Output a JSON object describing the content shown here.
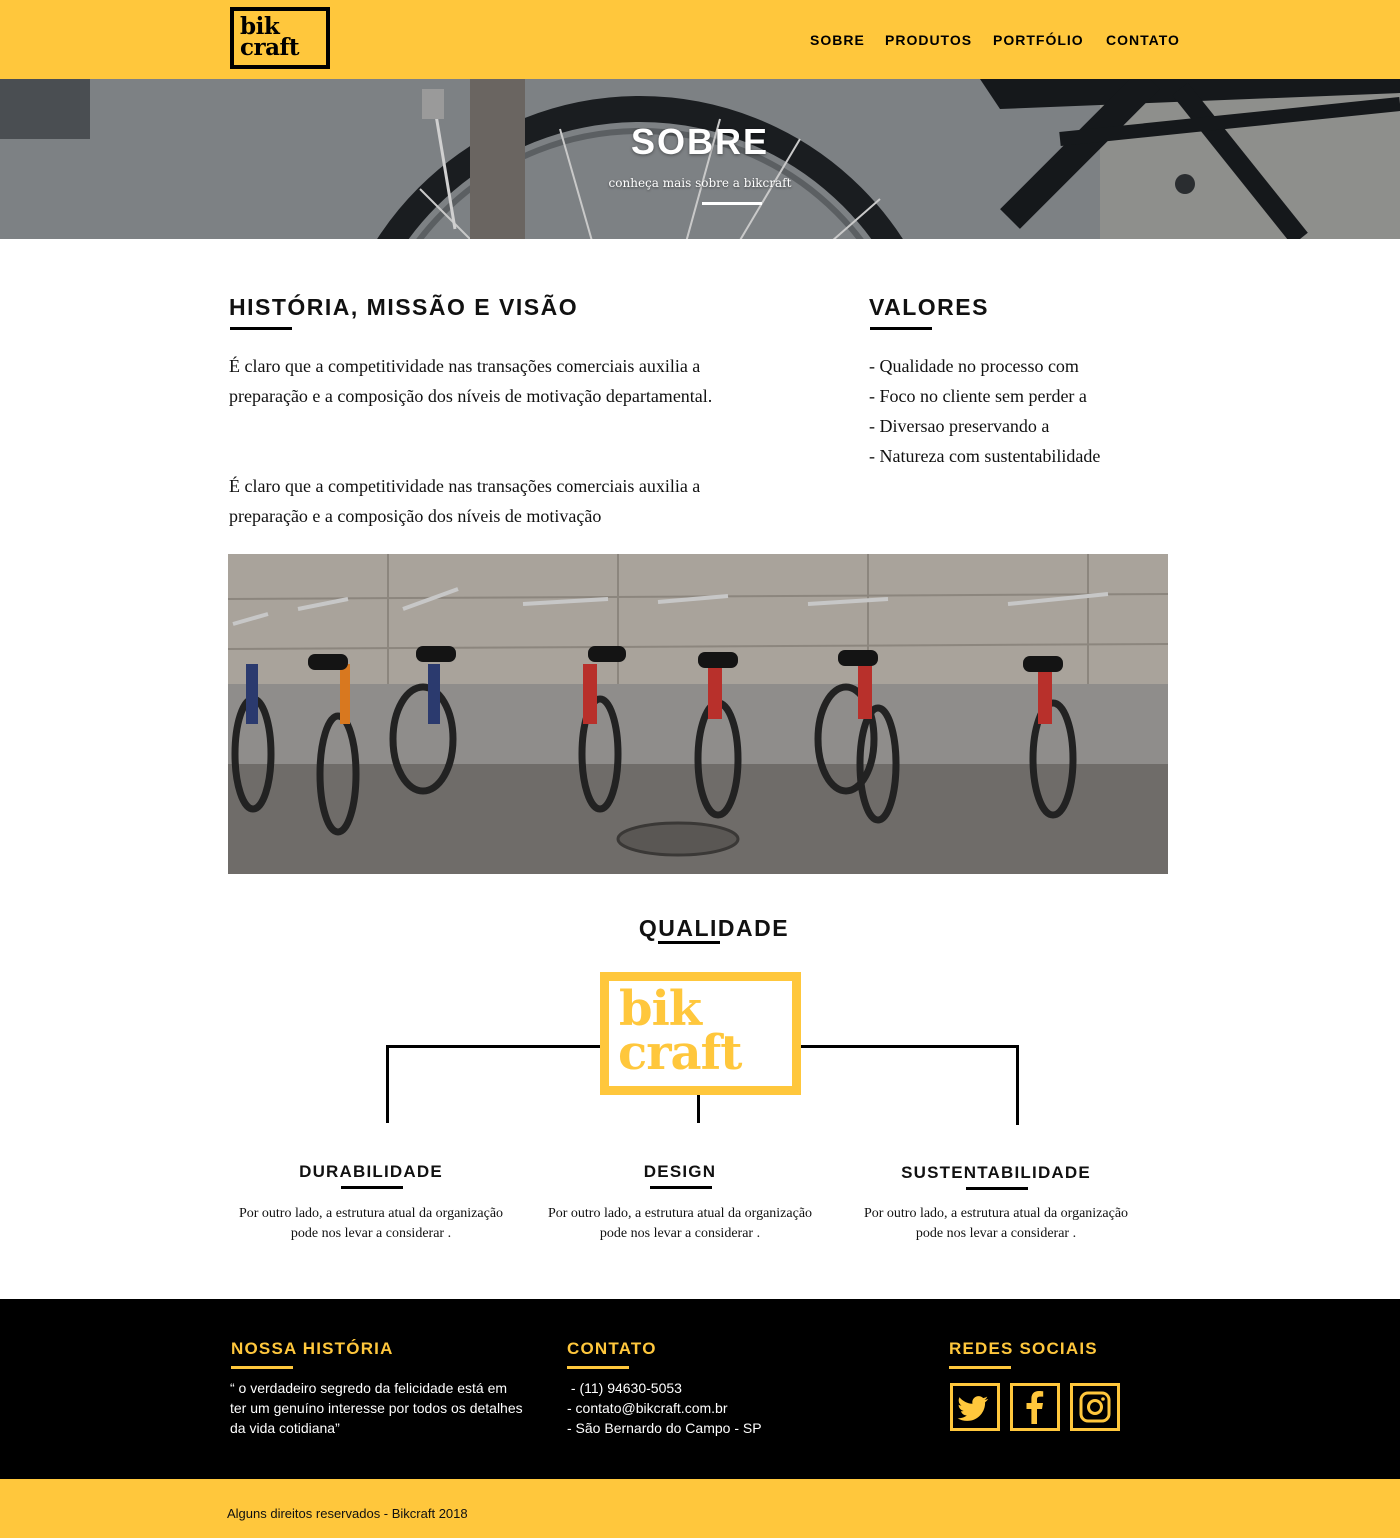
{
  "header": {
    "logo_line1": "bik",
    "logo_line2": "craft",
    "nav": [
      "SOBRE",
      "PRODUTOS",
      "PORTFÓLIO",
      "CONTATO"
    ]
  },
  "hero": {
    "title": "SOBRE",
    "subtitle": "conheça mais sobre a bikcraft"
  },
  "history": {
    "title": "HISTÓRIA, MISSÃO E VISÃO",
    "p1": "É claro que a competitividade nas transações comerciais auxilia a preparação e a composição dos níveis de motivação departamental.",
    "p2": "É claro que a competitividade nas transações comerciais auxilia a preparação e a composição dos níveis de motivação"
  },
  "values": {
    "title": "VALORES",
    "items": [
      "- Qualidade no processo com",
      "- Foco no cliente sem perder a",
      "- Diversao preservando a",
      "- Natureza com sustentabilidade"
    ]
  },
  "quality": {
    "title": "QUALIDADE",
    "logo_line1": "bik",
    "logo_line2": "craft",
    "pillars": [
      {
        "title": "DURABILIDADE",
        "text": "Por outro lado, a estrutura atual da organização pode nos levar a considerar ."
      },
      {
        "title": "DESIGN",
        "text": "Por outro lado, a estrutura atual da organização pode nos levar a considerar ."
      },
      {
        "title": "SUSTENTABILIDADE",
        "text": "Por outro lado, a estrutura atual da organização pode nos levar a considerar ."
      }
    ]
  },
  "footer": {
    "history_title": "NOSSA HISTÓRIA",
    "history_text": "“ o verdadeiro segredo da felicidade está  em ter um genuíno interesse por todos os detalhes da vida cotidiana”",
    "contact_title": "CONTATO",
    "contact_lines": [
      " - (11) 94630-5053",
      "- contato@bikcraft.com.br",
      "- São Bernardo do Campo - SP"
    ],
    "social_title": "REDES SOCIAIS",
    "social_icons": [
      "twitter-icon",
      "facebook-icon",
      "instagram-icon"
    ],
    "copyright": "Alguns direitos reservados - Bikcraft 2018"
  },
  "colors": {
    "brand_yellow": "#FFC73C",
    "text_dark": "#111111",
    "footer_bg": "#000000"
  }
}
